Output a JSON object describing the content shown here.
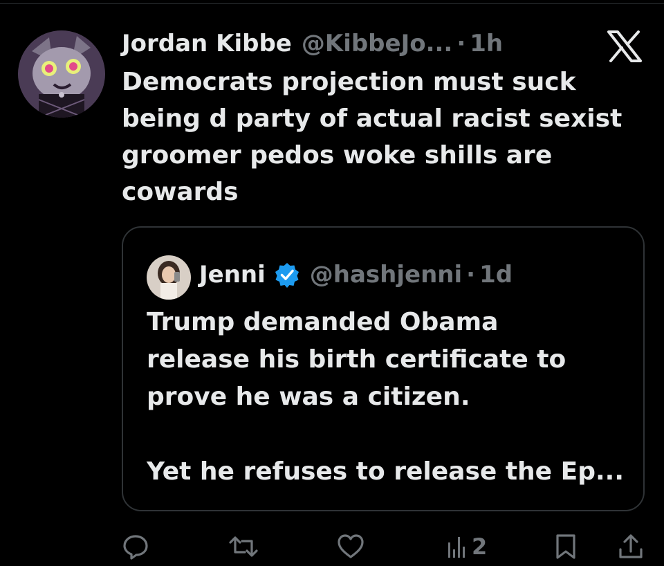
{
  "tweet": {
    "author_name": "Jordan Kibbe",
    "author_handle": "@KibbeJo...",
    "separator": "·",
    "time": "1h",
    "text": "Democrats projection must suck\nbeing d party of actual racist sexist\ngroomer pedos woke shills are\ncowards"
  },
  "quoted_tweet": {
    "author_name": "Jenni",
    "author_handle": "@hashjenni",
    "separator": "·",
    "time": "1d",
    "text": "Trump demanded Obama\nrelease his birth certificate to\nprove he was a citizen.\n\nYet he refuses to release the Ep..."
  },
  "actions": {
    "views_count": "2"
  },
  "icons": {
    "brand": "x-logo-icon",
    "verified": "verified-badge-icon",
    "reply": "reply-icon",
    "retweet": "retweet-icon",
    "like": "heart-icon",
    "views": "views-chart-icon",
    "bookmark": "bookmark-icon",
    "share": "share-icon"
  },
  "colors": {
    "background": "#000000",
    "text_primary": "#e7e9ea",
    "text_secondary": "#71767b",
    "border": "#2f3336",
    "verified_blue": "#1d9bf0"
  }
}
